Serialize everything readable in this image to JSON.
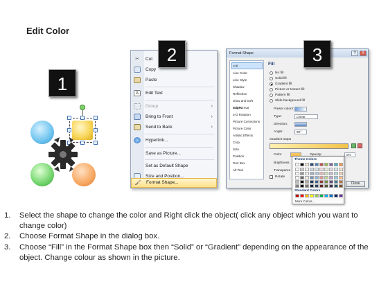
{
  "title": "Edit Color",
  "badges": [
    "1",
    "2",
    "3"
  ],
  "context_menu": {
    "items": [
      {
        "label": "Cut",
        "icon": "scissors-icon"
      },
      {
        "label": "Copy",
        "icon": "copy-icon"
      },
      {
        "label": "Paste",
        "icon": "paste-icon"
      },
      {
        "label": "Edit Text",
        "icon": "edit-text-icon"
      },
      {
        "label": "Group",
        "icon": "group-icon",
        "submenu": true,
        "disabled": true
      },
      {
        "label": "Bring to Front",
        "icon": "bring-front-icon",
        "submenu": true
      },
      {
        "label": "Send to Back",
        "icon": "send-back-icon",
        "submenu": true
      },
      {
        "label": "Hyperlink...",
        "icon": "hyperlink-icon"
      },
      {
        "label": "Save as Picture...",
        "icon": ""
      },
      {
        "label": "Set as Default Shape",
        "icon": ""
      },
      {
        "label": "Size and Position...",
        "icon": "size-position-icon"
      },
      {
        "label": "Format Shape...",
        "icon": "format-shape-icon",
        "highlighted": true
      }
    ],
    "arrow_glyph": "›"
  },
  "format_dialog": {
    "title": "Format Shape",
    "title_buttons": [
      "?",
      "X"
    ],
    "categories": [
      "Fill",
      "Line Color",
      "Line Style",
      "Shadow",
      "Reflection",
      "Glow and Soft Edges",
      "3-D Format",
      "3-D Rotation",
      "Picture Corrections",
      "Picture Color",
      "Artistic Effects",
      "Crop",
      "Size",
      "Position",
      "Text Box",
      "Alt Text"
    ],
    "selected_category": "Fill",
    "fill_heading": "Fill",
    "fill_options": [
      {
        "label": "No fill",
        "selected": false
      },
      {
        "label": "Solid fill",
        "selected": false
      },
      {
        "label": "Gradient fill",
        "selected": true
      },
      {
        "label": "Picture or texture fill",
        "selected": false
      },
      {
        "label": "Pattern fill",
        "selected": false
      },
      {
        "label": "Slide background fill",
        "selected": false
      }
    ],
    "preset_colors_label": "Preset colors:",
    "type_label": "Type:",
    "type_value": "Linear",
    "direction_label": "Direction:",
    "angle_label": "Angle:",
    "angle_value": "90°",
    "gradient_stops_label": "Gradient stops",
    "color_label": "Color",
    "opacity_label": "Opacity:",
    "opacity_value": "0%",
    "brightness_label": "Brightness",
    "transparency_label": "Transparen",
    "rotate_label": "Rotate",
    "close_button": "Close"
  },
  "theme_colors_popup": {
    "theme_label": "Theme Colors",
    "standard_label": "Standard Colors",
    "more_colors_label": "More Colors...",
    "theme_row": [
      "#ffffff",
      "#000000",
      "#eeece1",
      "#1f497d",
      "#4f81bd",
      "#c0504d",
      "#9bbb59",
      "#8064a2",
      "#4bacc6",
      "#f79646"
    ],
    "standard_row": [
      "#c00000",
      "#ff0000",
      "#ffc000",
      "#ffff00",
      "#92d050",
      "#00b050",
      "#00b0f0",
      "#0070c0",
      "#002060",
      "#7030a0"
    ]
  },
  "instructions": [
    {
      "num": "1.",
      "text": "Select the shape to change the color and Right click the object( click any object which you want to change color)"
    },
    {
      "num": "2.",
      "text": "Choose Format Shape in the dialog box."
    },
    {
      "num": "3.",
      "text": "Choose “Fill” in the Format Shape box then “Solid” or “Gradient” depending on the appearance of the object. Change colour as shown in the picture."
    }
  ]
}
